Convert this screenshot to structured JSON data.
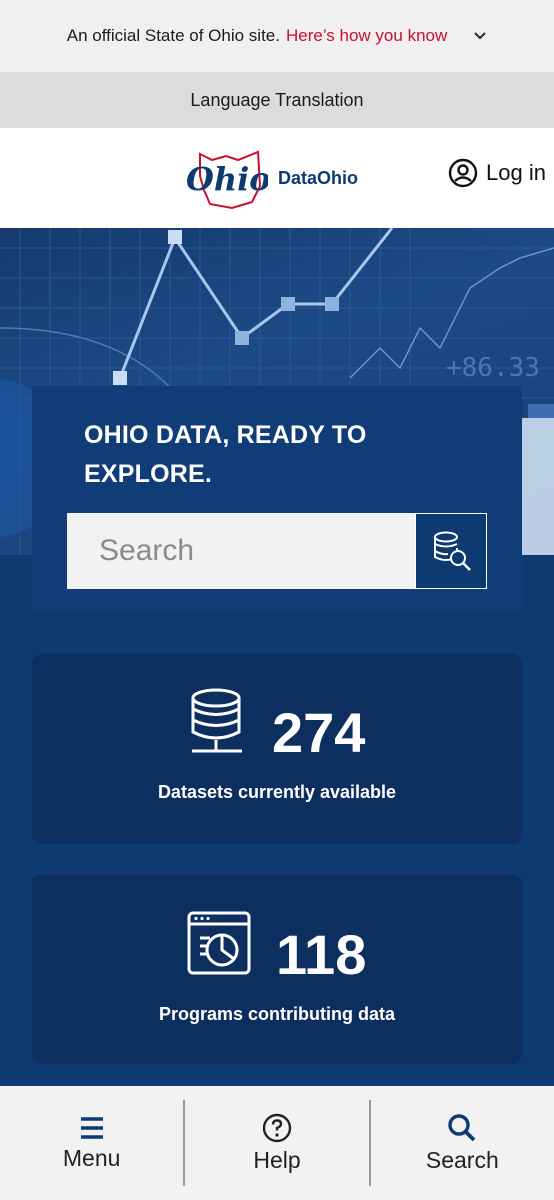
{
  "official_banner": {
    "text": "An official State of Ohio site.",
    "link": "Here’s how you know"
  },
  "language_bar": {
    "label": "Language Translation"
  },
  "header": {
    "logo_text": "Ohio",
    "brand_name": "DataOhio",
    "login_label": "Log in"
  },
  "hero": {
    "headline": "OHIO DATA, READY TO EXPLORE.",
    "search_placeholder": "Search",
    "ticker_text": "+86.33"
  },
  "stats": [
    {
      "value": "274",
      "label": "Datasets currently available",
      "icon": "database-icon"
    },
    {
      "value": "118",
      "label": "Programs contributing data",
      "icon": "dashboard-report-icon"
    }
  ],
  "bottom_nav": {
    "items": [
      {
        "label": "Menu",
        "icon": "hamburger-icon"
      },
      {
        "label": "Help",
        "icon": "question-circle-icon"
      },
      {
        "label": "Search",
        "icon": "search-icon"
      }
    ]
  },
  "colors": {
    "brand_navy": "#0e3a72",
    "card_navy": "#0c2f60",
    "link_red": "#c8102e"
  }
}
